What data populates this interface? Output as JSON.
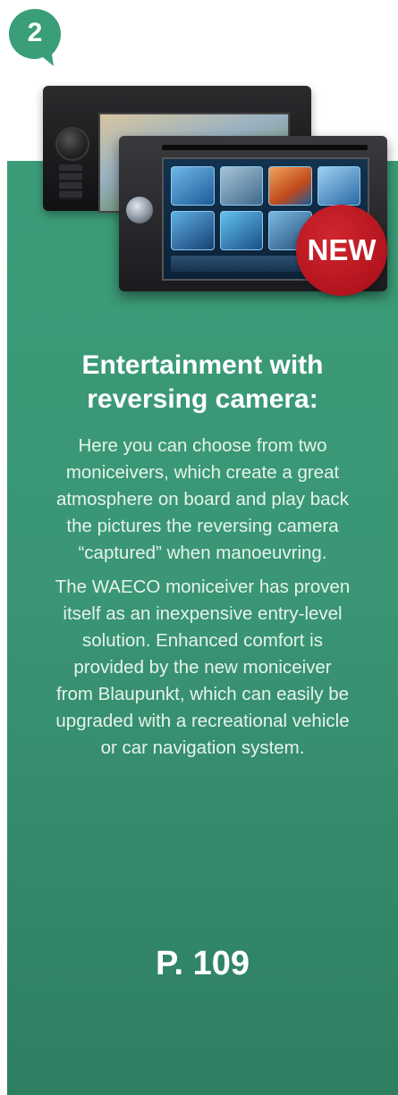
{
  "badge": {
    "number": "2",
    "color": "#3a9e78"
  },
  "card": {
    "color": "#3a9675",
    "new_label": "NEW",
    "new_color": "#c0171f"
  },
  "product_image": {
    "icon": "moniceiver-devices"
  },
  "heading": {
    "line1": "Entertainment with",
    "line2": "reversing camera:"
  },
  "paragraphs": [
    {
      "lines": [
        "Here you can choose from two",
        "moniceivers, which create a great",
        "atmosphere on board and play back",
        "the pictures the reversing camera",
        "“captured” when manoeuvring."
      ]
    },
    {
      "lines": [
        "The WAECO moniceiver has proven",
        "itself as an inexpensive entry-level",
        "solution. Enhanced comfort is",
        "provided by the new moniceiver",
        "from Blaupunkt, which can easily be",
        "upgraded with a recreational vehicle",
        "or car navigation system."
      ]
    }
  ],
  "page_reference": "P. 109"
}
